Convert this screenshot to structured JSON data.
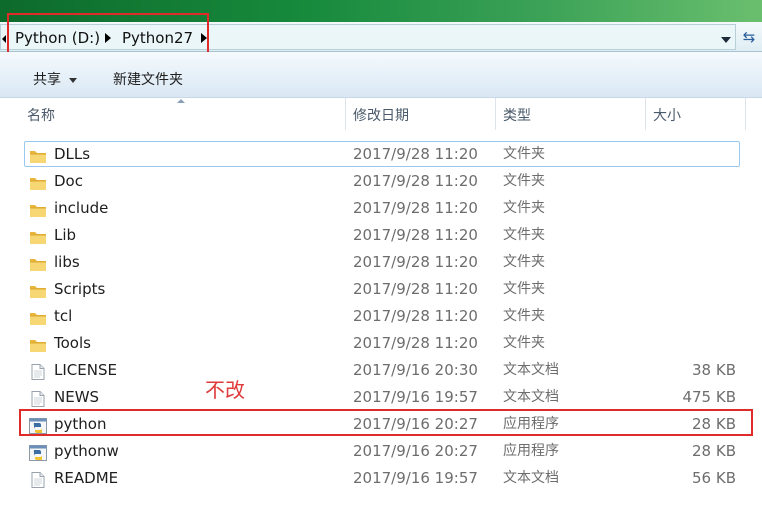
{
  "address": {
    "crumbs": [
      "Python (D:)",
      "Python27"
    ],
    "refresh_icon": "refresh-icon",
    "dropdown_icon": "chevron-down-icon"
  },
  "toolbar": {
    "share_label": "共享",
    "new_folder_label": "新建文件夹"
  },
  "columns": {
    "name": "名称",
    "date": "修改日期",
    "type": "类型",
    "size": "大小"
  },
  "files": [
    {
      "name": "DLLs",
      "date": "2017/9/28 11:20",
      "type": "文件夹",
      "size": "",
      "icon": "folder-icon",
      "selected": true
    },
    {
      "name": "Doc",
      "date": "2017/9/28 11:20",
      "type": "文件夹",
      "size": "",
      "icon": "folder-icon"
    },
    {
      "name": "include",
      "date": "2017/9/28 11:20",
      "type": "文件夹",
      "size": "",
      "icon": "folder-icon"
    },
    {
      "name": "Lib",
      "date": "2017/9/28 11:20",
      "type": "文件夹",
      "size": "",
      "icon": "folder-icon"
    },
    {
      "name": "libs",
      "date": "2017/9/28 11:20",
      "type": "文件夹",
      "size": "",
      "icon": "folder-icon"
    },
    {
      "name": "Scripts",
      "date": "2017/9/28 11:20",
      "type": "文件夹",
      "size": "",
      "icon": "folder-icon"
    },
    {
      "name": "tcl",
      "date": "2017/9/28 11:20",
      "type": "文件夹",
      "size": "",
      "icon": "folder-icon"
    },
    {
      "name": "Tools",
      "date": "2017/9/28 11:20",
      "type": "文件夹",
      "size": "",
      "icon": "folder-icon"
    },
    {
      "name": "LICENSE",
      "date": "2017/9/16 20:30",
      "type": "文本文档",
      "size": "38 KB",
      "icon": "text-file-icon"
    },
    {
      "name": "NEWS",
      "date": "2017/9/16 19:57",
      "type": "文本文档",
      "size": "475 KB",
      "icon": "text-file-icon"
    },
    {
      "name": "python",
      "date": "2017/9/16 20:27",
      "type": "应用程序",
      "size": "28 KB",
      "icon": "python-exe-icon"
    },
    {
      "name": "pythonw",
      "date": "2017/9/16 20:27",
      "type": "应用程序",
      "size": "28 KB",
      "icon": "python-exe-icon"
    },
    {
      "name": "README",
      "date": "2017/9/16 19:57",
      "type": "文本文档",
      "size": "56 KB",
      "icon": "text-file-icon"
    }
  ],
  "annotation": {
    "text": "不改"
  },
  "colors": {
    "highlight_box": "#e02b2b",
    "selection_border": "#99c9ef",
    "folder": "#f0c24c"
  }
}
